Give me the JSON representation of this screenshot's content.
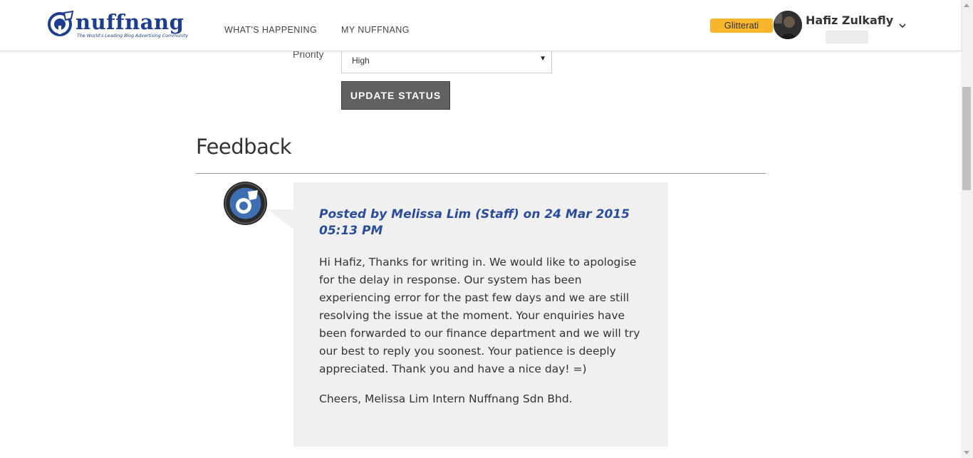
{
  "brand": {
    "name": "nuffnang",
    "tagline": "The World's Leading Blog Advertising Community"
  },
  "nav": {
    "whats_happening": "WHAT'S HAPPENING",
    "my_nuffnang": "MY NUFFNANG"
  },
  "user": {
    "badge": "Glitterati",
    "name": "Hafiz Zulkafly"
  },
  "form": {
    "priority_label": "Priority",
    "priority_value": "High",
    "update_button": "UPDATE STATUS"
  },
  "feedback": {
    "title": "Feedback",
    "posted_by": "Posted by Melissa Lim (Staff) on 24 Mar 2015 05:13 PM",
    "message": "Hi Hafiz, Thanks for writing in. We would like to apologise for the delay in response. Our system has been experiencing error for the past few days and we are still resolving the issue at the moment. Your enquiries have been forwarded to our finance department and we will try our best to reply you soonest. Your patience is deeply appreciated. Thank you and have a nice day! =)",
    "signoff": "Cheers, Melissa Lim Intern Nuffnang Sdn Bhd."
  },
  "colors": {
    "brand_blue": "#1d3d8f",
    "badge": "#f7b62c",
    "post_heading": "#2a4d9b",
    "button": "#616161",
    "bubble": "#f0f0f0"
  }
}
